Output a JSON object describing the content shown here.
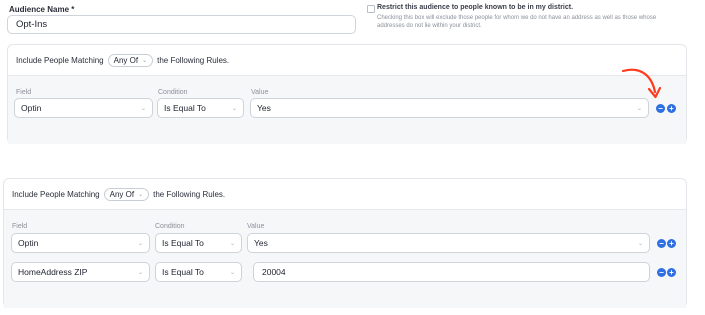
{
  "audience": {
    "name_label": "Audience Name *",
    "name_value": "Opt-Ins"
  },
  "restrict": {
    "label": "Restrict this audience to people known to be in my district.",
    "description_line1": "Checking this box will exclude those people for whom we do not have an address as well as those whose",
    "description_line2": "addresses do not lie within your district."
  },
  "group1": {
    "include_text": "Include People Matching",
    "match_value": "Any Of",
    "following_text": "the Following Rules.",
    "columns": {
      "field": "Field",
      "condition": "Condition",
      "value": "Value"
    },
    "rows": [
      {
        "field": "Optin",
        "condition": "Is Equal To",
        "value": "Yes"
      }
    ]
  },
  "group2": {
    "include_text": "Include People Matching",
    "match_value": "Any Of",
    "following_text": "the Following Rules.",
    "columns": {
      "field": "Field",
      "condition": "Condition",
      "value": "Value"
    },
    "rows": [
      {
        "field": "Optin",
        "condition": "Is Equal To",
        "value": "Yes"
      },
      {
        "field": "HomeAddress ZIP",
        "condition": "Is Equal To",
        "value": "20004"
      }
    ]
  },
  "buttons": {
    "remove_symbol": "−",
    "add_symbol": "+"
  },
  "colors": {
    "accent": "#2f6fe0",
    "annotation_arrow": "#ff3b1f"
  }
}
